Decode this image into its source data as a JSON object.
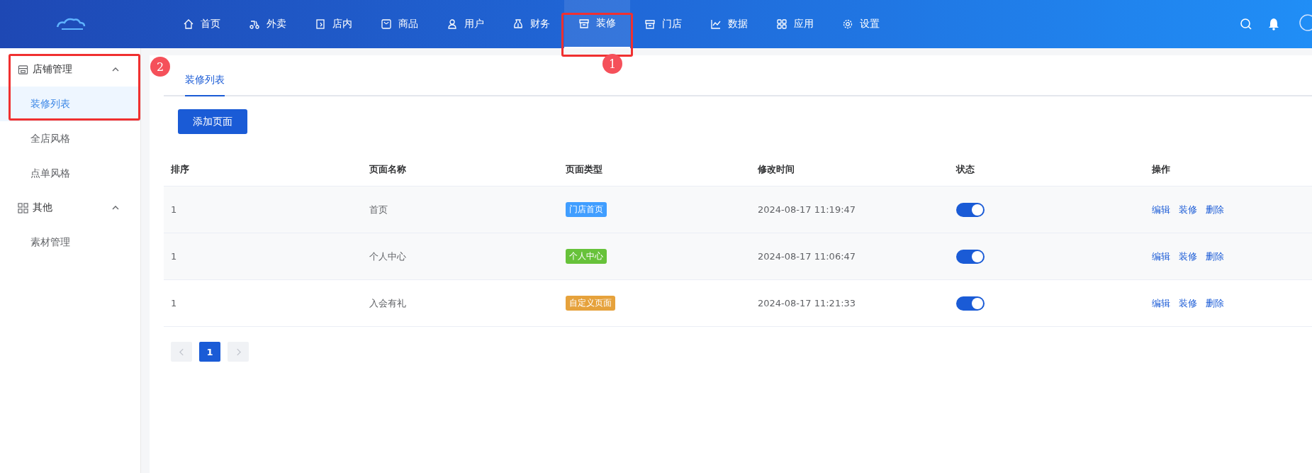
{
  "nav": [
    {
      "label": "首页",
      "selected": false
    },
    {
      "label": "外卖",
      "selected": false
    },
    {
      "label": "店内",
      "selected": false
    },
    {
      "label": "商品",
      "selected": false
    },
    {
      "label": "用户",
      "selected": false
    },
    {
      "label": "财务",
      "selected": false
    },
    {
      "label": "装修",
      "selected": true
    },
    {
      "label": "门店",
      "selected": false
    },
    {
      "label": "数据",
      "selected": false
    },
    {
      "label": "应用",
      "selected": false
    },
    {
      "label": "设置",
      "selected": false
    }
  ],
  "sidebar": [
    {
      "label": "店铺管理",
      "expanded": true,
      "children": [
        {
          "label": "装修列表",
          "selected": true
        },
        {
          "label": "全店风格",
          "selected": false
        },
        {
          "label": "点单风格",
          "selected": false
        }
      ]
    },
    {
      "label": "其他",
      "expanded": true,
      "children": [
        {
          "label": "素材管理",
          "selected": false
        }
      ]
    }
  ],
  "tabs": [
    {
      "label": "装修列表",
      "selected": true
    }
  ],
  "add_button": "添加页面",
  "table": {
    "columns": [
      "排序",
      "页面名称",
      "页面类型",
      "修改时间",
      "状态",
      "操作"
    ],
    "rows": [
      {
        "order": "1",
        "name": "首页",
        "type": "门店首页",
        "color": "#409eff",
        "time": "2024-08-17 11:19:47",
        "on": true,
        "actions": [
          "编辑",
          "装修",
          "删除"
        ]
      },
      {
        "order": "1",
        "name": "个人中心",
        "type": "个人中心",
        "color": "#67c23a",
        "time": "2024-08-17 11:06:47",
        "on": true,
        "actions": [
          "编辑",
          "装修",
          "删除"
        ]
      },
      {
        "order": "1",
        "name": "入会有礼",
        "type": "自定义页面",
        "color": "#e6a23c",
        "time": "2024-08-17 11:21:33",
        "on": true,
        "actions": [
          "编辑",
          "装修",
          "删除"
        ]
      }
    ]
  },
  "pagination": {
    "pages": [
      {
        "label": "1",
        "selected": true
      }
    ]
  },
  "annotations": [
    {
      "label": "2"
    },
    {
      "label": "1"
    }
  ]
}
